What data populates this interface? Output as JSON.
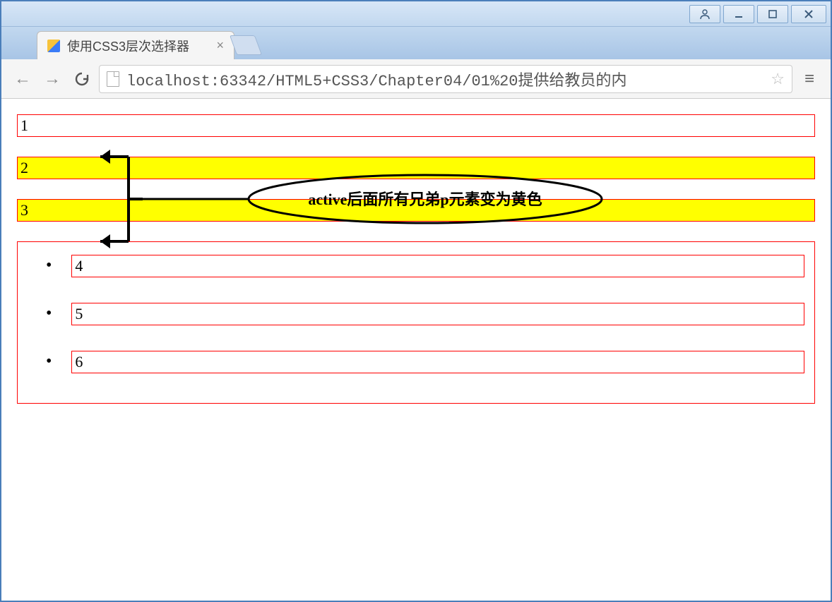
{
  "window": {
    "tab_title": "使用CSS3层次选择器"
  },
  "address_bar": {
    "url": "localhost:63342/HTML5+CSS3/Chapter04/01%20提供给教员的内"
  },
  "content": {
    "p1": "1",
    "p2": "2",
    "p3": "3",
    "list": [
      "4",
      "5",
      "6"
    ],
    "highlighted": [
      false,
      true,
      true
    ]
  },
  "annotation": {
    "text": "active后面所有兄弟p元素变为黄色"
  }
}
